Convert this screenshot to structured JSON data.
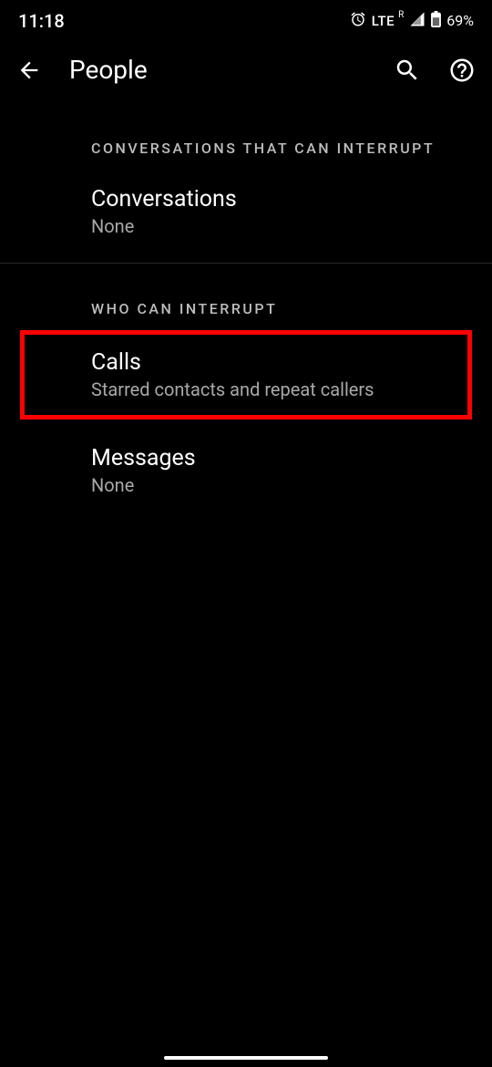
{
  "statusBar": {
    "time": "11:18",
    "network": "LTE",
    "roaming": "R",
    "battery": "69%"
  },
  "header": {
    "title": "People"
  },
  "sections": {
    "conversations": {
      "header": "CONVERSATIONS THAT CAN INTERRUPT",
      "items": [
        {
          "title": "Conversations",
          "subtitle": "None"
        }
      ]
    },
    "whoCanInterrupt": {
      "header": "WHO CAN INTERRUPT",
      "items": [
        {
          "title": "Calls",
          "subtitle": "Starred contacts and repeat callers"
        },
        {
          "title": "Messages",
          "subtitle": "None"
        }
      ]
    }
  }
}
